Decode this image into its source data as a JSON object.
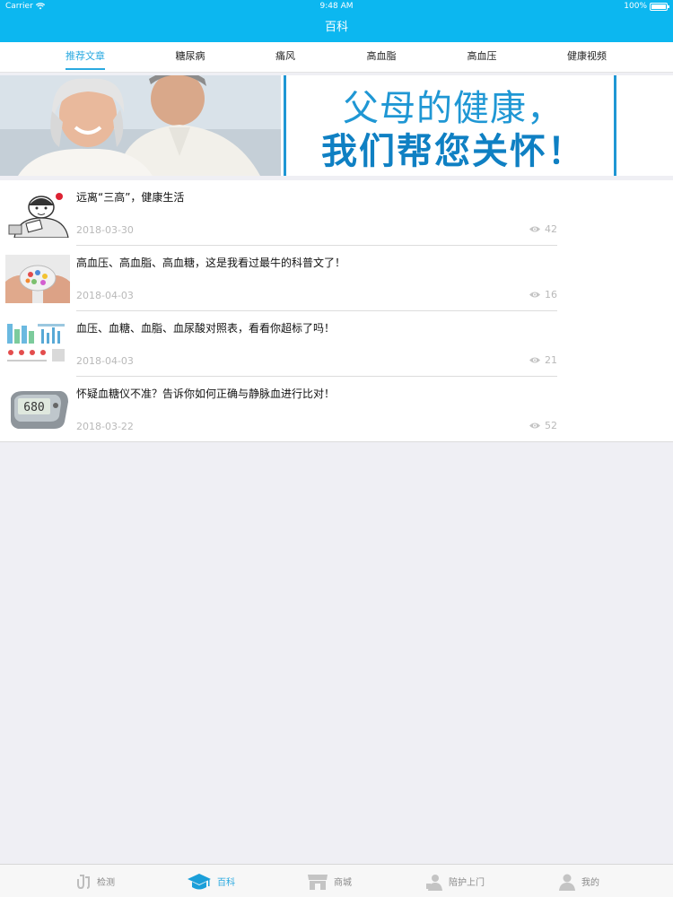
{
  "status_bar": {
    "carrier": "Carrier",
    "time": "9:48 AM",
    "battery": "100%"
  },
  "nav": {
    "title": "百科"
  },
  "tabs": [
    {
      "label": "推荐文章",
      "active": true
    },
    {
      "label": "糖尿病",
      "active": false
    },
    {
      "label": "痛风",
      "active": false
    },
    {
      "label": "高血脂",
      "active": false
    },
    {
      "label": "高血压",
      "active": false
    },
    {
      "label": "健康视频",
      "active": false
    }
  ],
  "banner": {
    "line1": "父母的健康，",
    "line2": "我们帮您关怀！"
  },
  "articles": [
    {
      "title": "远离“三高”，健康生活",
      "date": "2018-03-30",
      "views": "42",
      "thumb": "cartoon-doctor"
    },
    {
      "title": "高血压、高血脂、高血糖，这是我看过最牛的科普文了！",
      "date": "2018-04-03",
      "views": "16",
      "thumb": "pills-in-hands"
    },
    {
      "title": "血压、血糖、血脂、血尿酸对照表，看看你超标了吗！",
      "date": "2018-04-03",
      "views": "21",
      "thumb": "reference-chart"
    },
    {
      "title": "怀疑血糖仪不准？告诉你如何正确与静脉血进行比对！",
      "date": "2018-03-22",
      "views": "52",
      "thumb": "glucose-meter"
    }
  ],
  "tabbar": [
    {
      "label": "检测",
      "icon": "test-tube-icon",
      "active": false
    },
    {
      "label": "百科",
      "icon": "graduation-cap-icon",
      "active": true
    },
    {
      "label": "商城",
      "icon": "store-icon",
      "active": false
    },
    {
      "label": "陪护上门",
      "icon": "nurse-icon",
      "active": false
    },
    {
      "label": "我的",
      "icon": "user-icon",
      "active": false
    }
  ],
  "colors": {
    "accent": "#0cb7f0",
    "tab_active": "#2aa9e0",
    "banner_text": "#1f97d4"
  }
}
